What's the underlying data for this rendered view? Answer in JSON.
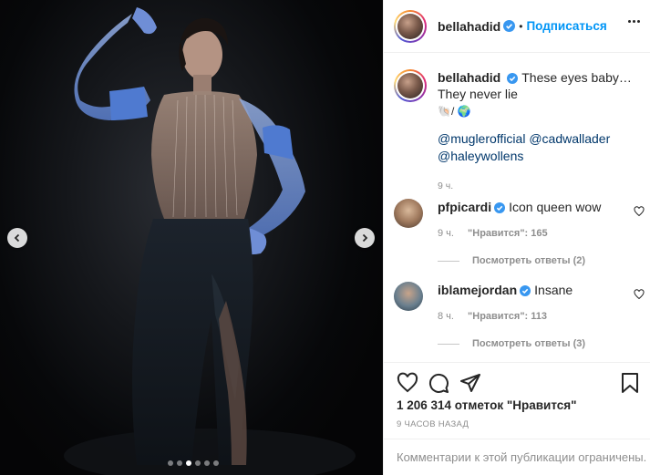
{
  "post": {
    "author": "bellahadid",
    "follow_label": "Подписаться",
    "header_separator": "•",
    "photo_dots": 6,
    "photo_active_dot": 3
  },
  "caption": {
    "username": "bellahadid",
    "text_line1": "These eyes baby…",
    "text_line2": "They never lie",
    "emoji_line": "🐚/ 🌍",
    "mentions": [
      "@muglerofficial",
      "@cadwallader",
      "@haleywollens"
    ],
    "time": "9 ч."
  },
  "comments": [
    {
      "username": "pfpicardi",
      "text": "Icon queen wow",
      "time": "9 ч.",
      "likes": "\"Нравится\": 165",
      "replies": "Посмотреть ответы (2)"
    },
    {
      "username": "iblamejordan",
      "text": "Insane",
      "time": "8 ч.",
      "likes": "\"Нравится\": 113",
      "replies": "Посмотреть ответы (3)"
    }
  ],
  "stats": {
    "likes_text": "1 206 314 отметок \"Нравится\"",
    "posted": "9 ЧАСОВ НАЗАД",
    "comments_limited": "Комментарии к этой публикации ограничены."
  },
  "colors": {
    "accent": "#0095f6",
    "verified": "#3897f0",
    "mention": "#00376b",
    "muted": "#8e8e8e"
  },
  "icons": {
    "like": "heart-icon",
    "comment": "comment-icon",
    "share": "paper-plane-icon",
    "save": "bookmark-icon",
    "more": "more-horizontal-icon",
    "prev": "chevron-left-icon",
    "next": "chevron-right-icon"
  }
}
